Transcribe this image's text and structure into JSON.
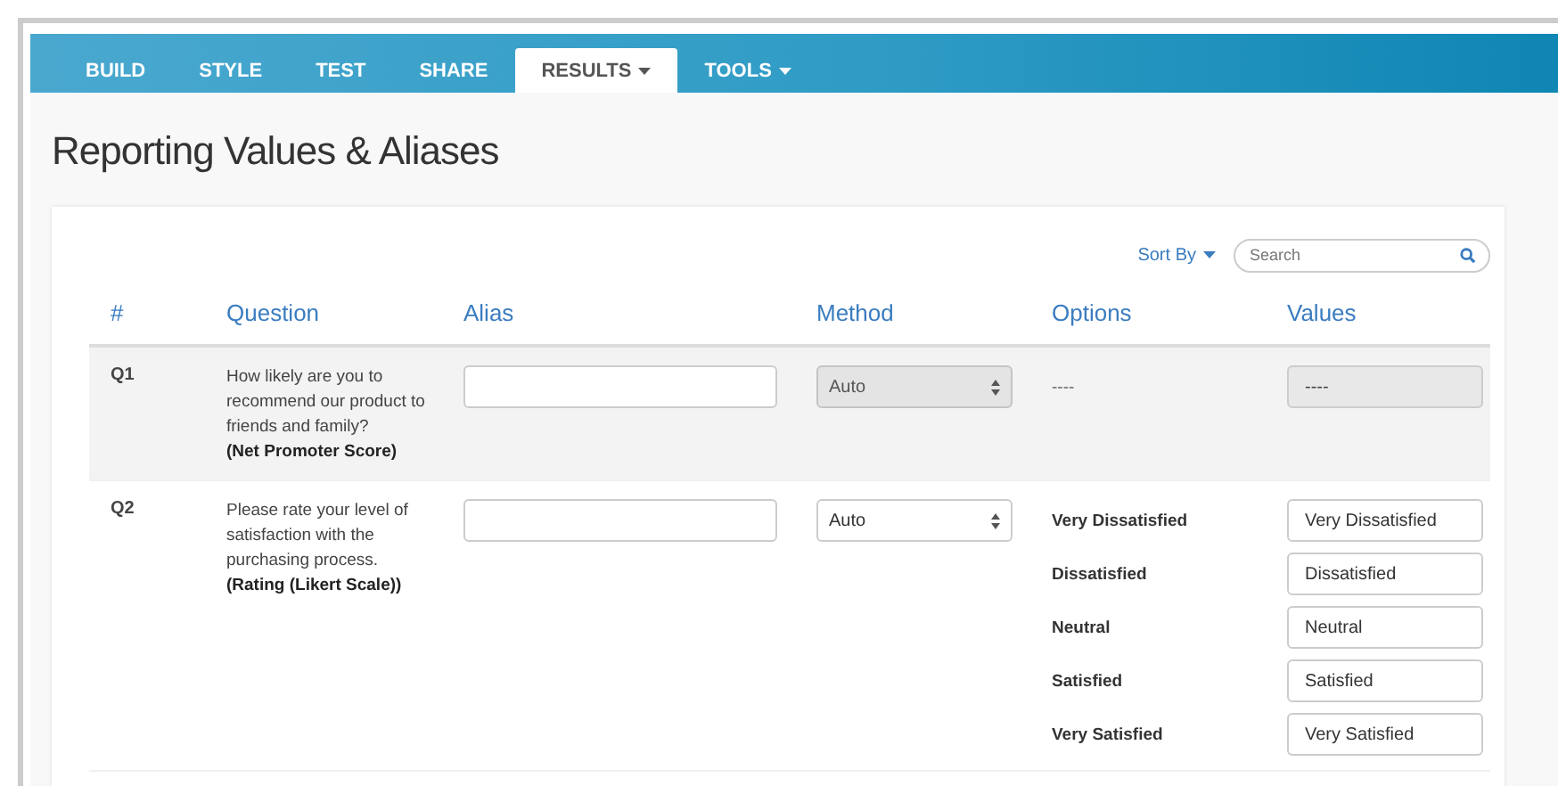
{
  "tabs": [
    {
      "label": "BUILD",
      "selected": false,
      "dropdown": false
    },
    {
      "label": "STYLE",
      "selected": false,
      "dropdown": false
    },
    {
      "label": "TEST",
      "selected": false,
      "dropdown": false
    },
    {
      "label": "SHARE",
      "selected": false,
      "dropdown": false
    },
    {
      "label": "RESULTS",
      "selected": true,
      "dropdown": true
    },
    {
      "label": "TOOLS",
      "selected": false,
      "dropdown": true
    }
  ],
  "page_title": "Reporting Values & Aliases",
  "toolbar": {
    "sort_by": "Sort By",
    "search": {
      "placeholder": "Search"
    }
  },
  "table": {
    "columns": [
      "#",
      "Question",
      "Alias",
      "Method",
      "Options",
      "Values"
    ],
    "rows": [
      {
        "number": "Q1",
        "question": "How likely are you to recommend our product to friends and family?",
        "question_type": "(Net Promoter Score)",
        "highlighted": true,
        "method": "Auto",
        "method_disabled": true,
        "options": [
          {
            "label": "----",
            "value": "----",
            "disabled": true
          }
        ]
      },
      {
        "number": "Q2",
        "question": "Please rate your level of satisfaction with the purchasing process.",
        "question_type": "(Rating (Likert Scale))",
        "highlighted": false,
        "method": "Auto",
        "method_disabled": false,
        "options": [
          {
            "label": "Very Dissatisfied",
            "value": "Very Dissatisfied",
            "disabled": false
          },
          {
            "label": "Dissatisfied",
            "value": "Dissatisfied",
            "disabled": false
          },
          {
            "label": "Neutral",
            "value": "Neutral",
            "disabled": false
          },
          {
            "label": "Satisfied",
            "value": "Satisfied",
            "disabled": false
          },
          {
            "label": "Very Satisfied",
            "value": "Very Satisfied",
            "disabled": false
          }
        ]
      }
    ]
  }
}
